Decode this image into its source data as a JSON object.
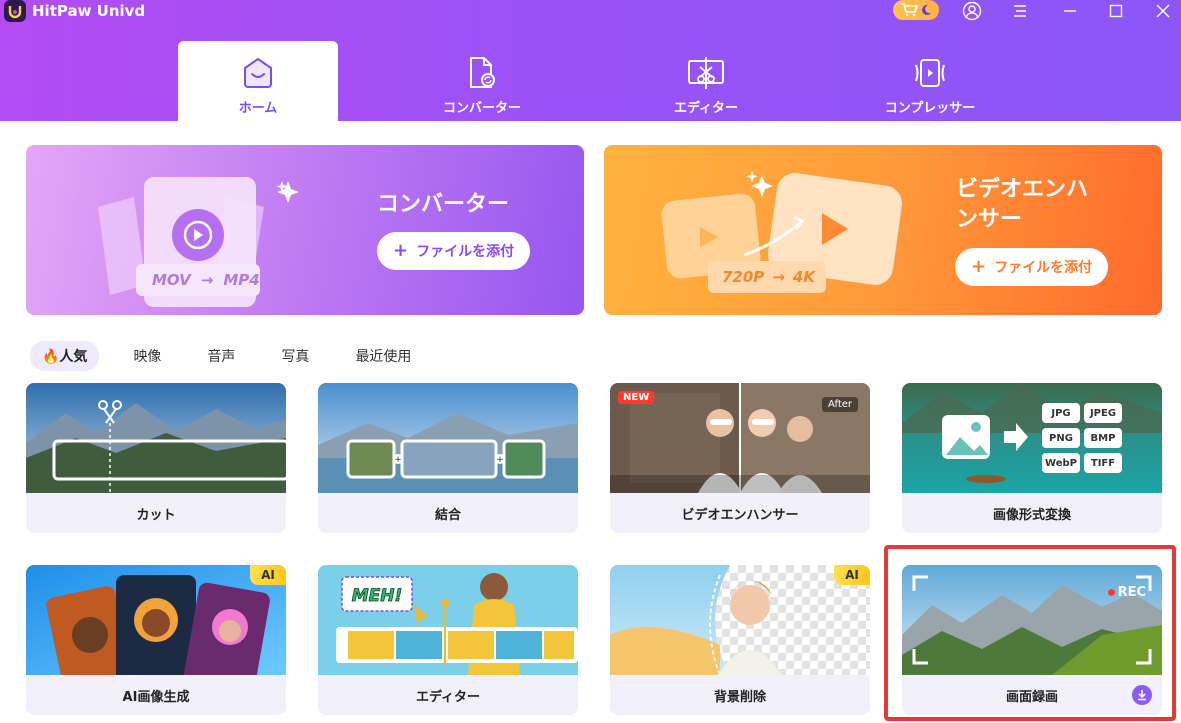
{
  "app": {
    "title": "HitPaw Univd"
  },
  "titlebar": {
    "icons": [
      "shop-cart-icon",
      "user-icon",
      "menu-icon",
      "minimize-icon",
      "maximize-icon",
      "close-icon"
    ]
  },
  "nav": {
    "tabs": [
      {
        "label": "ホーム",
        "icon": "home-icon",
        "active": true
      },
      {
        "label": "コンバーター",
        "icon": "converter-icon",
        "active": false
      },
      {
        "label": "エディター",
        "icon": "editor-icon",
        "active": false
      },
      {
        "label": "コンプレッサー",
        "icon": "compressor-icon",
        "active": false
      }
    ]
  },
  "banners": {
    "converter": {
      "title": "コンバーター",
      "button": "ファイルを添付",
      "format_from": "MOV",
      "format_to": "MP4"
    },
    "enhancer": {
      "title_line1": "ビデオエンハ",
      "title_line2": "ンサー",
      "button": "ファイルを添付",
      "res_from": "720P",
      "res_to": "4K"
    }
  },
  "categories": [
    {
      "label": "🔥人気",
      "active": true
    },
    {
      "label": "映像",
      "active": false
    },
    {
      "label": "音声",
      "active": false
    },
    {
      "label": "写真",
      "active": false
    },
    {
      "label": "最近使用",
      "active": false
    }
  ],
  "tools": [
    {
      "label": "カット"
    },
    {
      "label": "結合"
    },
    {
      "label": "ビデオエンハンサー",
      "badge": "NEW",
      "tag": "After"
    },
    {
      "label": "画像形式変換",
      "formats": [
        "JPG",
        "JPEG",
        "PNG",
        "BMP",
        "WebP",
        "TIFF"
      ]
    },
    {
      "label": "AI画像生成",
      "badge": "AI"
    },
    {
      "label": "エディター",
      "sticker": "MEH!"
    },
    {
      "label": "背景削除",
      "badge": "AI"
    },
    {
      "label": "画面録画",
      "rec": "REC"
    }
  ],
  "colors": {
    "header_start": "#b34cf3",
    "header_end": "#8c56f7",
    "accent": "#7a4df2",
    "converter_banner": "#c37ef2",
    "enhancer_banner": "#ff8a35",
    "highlight": "#e53935"
  }
}
